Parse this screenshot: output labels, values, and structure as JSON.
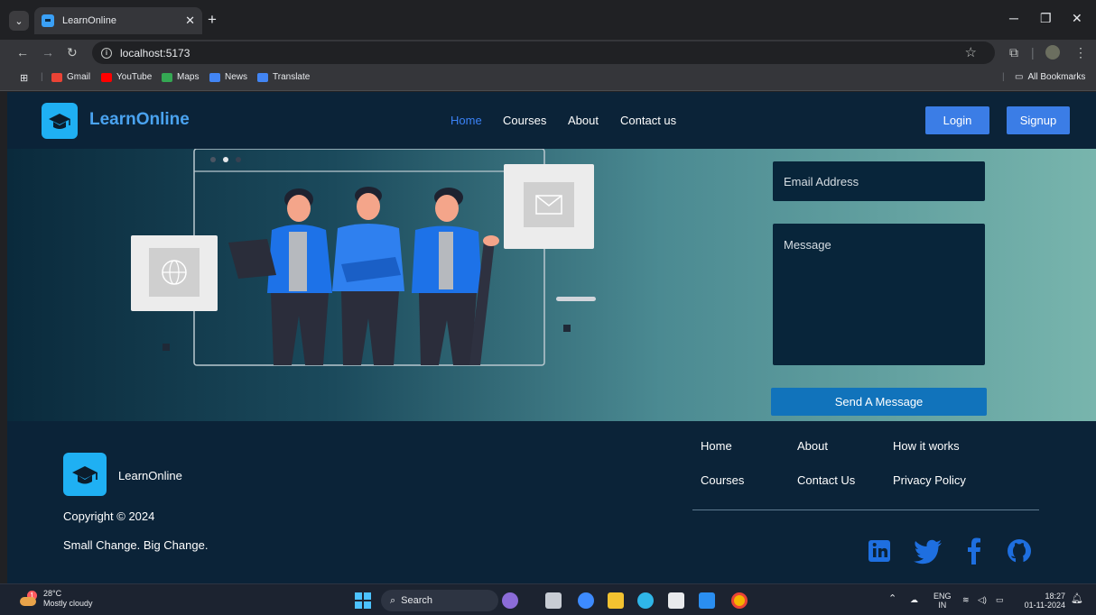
{
  "browser": {
    "tab_title": "LearnOnline",
    "tab_close": "✕",
    "new_tab": "+",
    "url": "localhost:5173",
    "bookmarks": [
      "Gmail",
      "YouTube",
      "Maps",
      "News",
      "Translate"
    ],
    "all_bookmarks": "All Bookmarks"
  },
  "navbar": {
    "brand": "LearnOnline",
    "links": [
      "Home",
      "Courses",
      "About",
      "Contact us"
    ],
    "active_link": "Home",
    "login": "Login",
    "signup": "Signup"
  },
  "contact_form": {
    "email_placeholder": "Email Address",
    "message_placeholder": "Message",
    "submit": "Send A Message"
  },
  "footer": {
    "brand": "LearnOnline",
    "copyright": "Copyright © 2024",
    "tagline": "Small Change. Big Change.",
    "links": [
      [
        "Home",
        "About",
        "How it works"
      ],
      [
        "Courses",
        "Contact Us",
        "Privacy Policy"
      ]
    ],
    "social": [
      "linkedin-icon",
      "twitter-icon",
      "facebook-icon",
      "github-icon"
    ]
  },
  "taskbar": {
    "weather_temp": "28°C",
    "weather_desc": "Mostly cloudy",
    "weather_badge": "1",
    "search": "Search",
    "lang_top": "ENG",
    "lang_bottom": "IN",
    "time": "18:27",
    "date": "01-11-2024"
  },
  "colors": {
    "page_bg": "#0b2338",
    "accent": "#3b7de6",
    "brand_blue": "#4aa3f0",
    "send_button": "#1173bb",
    "social_blue": "#1e6fe0"
  }
}
